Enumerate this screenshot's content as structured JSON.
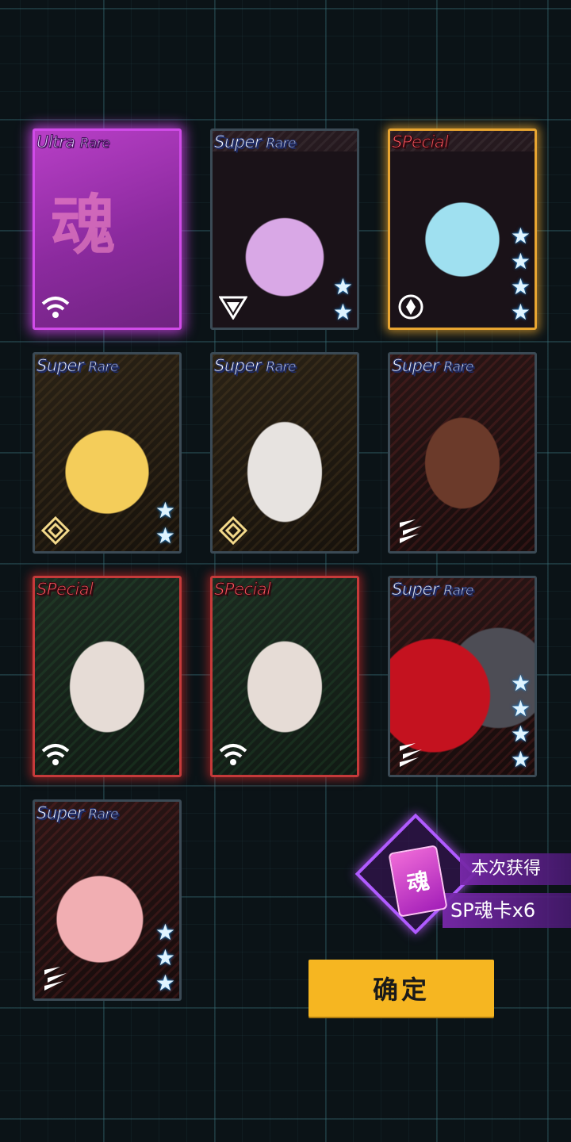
{
  "cards": [
    {
      "rarity_main": "Ultra",
      "rarity_sub": "Rare",
      "glyph": "魂",
      "class": "wifi-icon",
      "stars": 0
    },
    {
      "rarity_main": "Super",
      "rarity_sub": "Rare",
      "class": "triangle-icon",
      "stars": 2
    },
    {
      "rarity_main": "SPecial",
      "rarity_sub": "",
      "class": "ring-icon",
      "stars": 4
    },
    {
      "rarity_main": "Super",
      "rarity_sub": "Rare",
      "class": "diamond-icon",
      "stars": 2
    },
    {
      "rarity_main": "Super",
      "rarity_sub": "Rare",
      "class": "diamond-icon",
      "stars": 0
    },
    {
      "rarity_main": "Super",
      "rarity_sub": "Rare",
      "class": "slash-icon",
      "stars": 0
    },
    {
      "rarity_main": "SPecial",
      "rarity_sub": "",
      "class": "wifi-icon",
      "stars": 0
    },
    {
      "rarity_main": "SPecial",
      "rarity_sub": "",
      "class": "wifi-icon",
      "stars": 0
    },
    {
      "rarity_main": "Super",
      "rarity_sub": "Rare",
      "class": "slash-icon",
      "stars": 4
    },
    {
      "rarity_main": "Super",
      "rarity_sub": "Rare",
      "class": "slash-icon",
      "stars": 3
    }
  ],
  "reward": {
    "card_glyph": "魂",
    "label": "本次获得",
    "amount": "SP魂卡x6"
  },
  "confirm_label": "确定",
  "colors": {
    "ultra_rare_glow": "#d04be8",
    "special_gold": "#e8a531",
    "special_red": "#c53a3a",
    "button": "#f6b621"
  }
}
